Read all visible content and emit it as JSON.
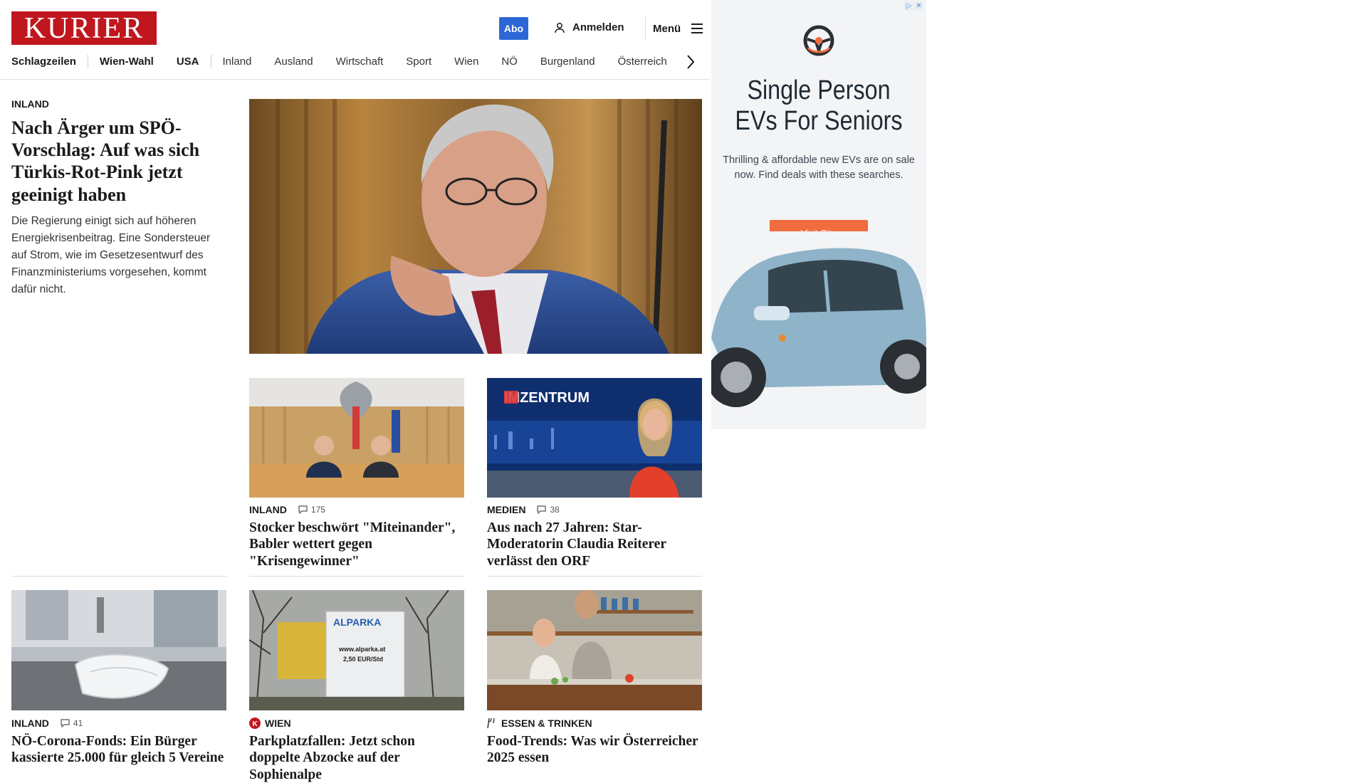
{
  "header": {
    "logo_text": "KURIER",
    "abo_label": "Abo",
    "login_label": "Anmelden",
    "menu_label": "Menü"
  },
  "nav": {
    "items": [
      "Schlagzeilen",
      "Wien-Wahl",
      "USA",
      "Inland",
      "Ausland",
      "Wirtschaft",
      "Sport",
      "Wien",
      "NÖ",
      "Burgenland",
      "Österreich"
    ]
  },
  "lead": {
    "kicker": "INLAND",
    "headline": "Nach Ärger um SPÖ-Vorschlag: Auf was sich Türkis-Rot-Pink jetzt geeinigt haben",
    "teaser": "Die Regierung einigt sich auf höheren Energiekrisenbeitrag. Eine Sondersteuer auf Strom, wie im Gesetzesentwurf des Finanzministeriums vorgesehen, kommt dafür nicht."
  },
  "cards": [
    {
      "kicker": "INLAND",
      "comments": "175",
      "headline": "Stocker beschwört \"Miteinander\", Babler wettert gegen \"Krisengewinner\""
    },
    {
      "kicker": "MEDIEN",
      "comments": "38",
      "headline": "Aus nach 27 Jahren: Star-Moderatorin Claudia Reiterer verlässt den ORF",
      "image_text": "IMZENTRUM"
    },
    {
      "kicker": "INLAND",
      "comments": "41",
      "headline": "NÖ-Corona-Fonds: Ein Bürger kassierte 25.000 für gleich 5 Vereine"
    },
    {
      "kicker": "WIEN",
      "headline": "Parkplatzfallen: Jetzt schon doppelte Abzocke auf der Sophienalpe",
      "sign_brand": "ALPARKA",
      "sign_url": "www.alparka.at",
      "sign_price": "2,50 EUR/Std"
    },
    {
      "kicker": "ESSEN & TRINKEN",
      "headline": "Food-Trends: Was wir Österreicher 2025 essen"
    }
  ],
  "ad": {
    "title": "Single Person EVs For Seniors",
    "text": "Thrilling & affordable new EVs are on sale now. Find deals with these searches.",
    "button": "Visit Site",
    "adchoices_label": "▷",
    "close_label": "✕"
  },
  "colors": {
    "brand_red": "#c0161e",
    "abo_blue": "#2d67d7",
    "ad_button": "#f06b3e"
  }
}
